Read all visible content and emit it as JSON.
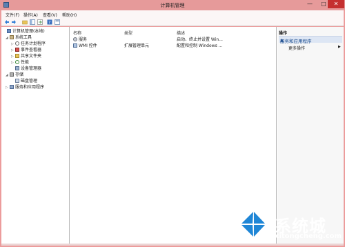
{
  "window": {
    "title": "计算机管理",
    "controls": {
      "minimize": "—",
      "maximize": "□",
      "close": "✕"
    }
  },
  "menubar": {
    "items": [
      "文件(F)",
      "操作(A)",
      "查看(V)",
      "帮助(H)"
    ]
  },
  "toolbar": {
    "buttons": [
      "back-arrow-icon",
      "forward-arrow-icon",
      "folder-up-icon",
      "show-hide-tree-icon",
      "export-list-icon",
      "help-icon",
      "properties-icon"
    ]
  },
  "tree": {
    "items": [
      {
        "label": "计算机管理(本地)",
        "depth": 0,
        "expander": "",
        "icon": "computer-icon"
      },
      {
        "label": "系统工具",
        "depth": 1,
        "expander": "◢",
        "icon": "tools-icon"
      },
      {
        "label": "任务计划程序",
        "depth": 2,
        "expander": "▷",
        "icon": "clock-icon"
      },
      {
        "label": "事件查看器",
        "depth": 2,
        "expander": "▷",
        "icon": "event-viewer-icon"
      },
      {
        "label": "共享文件夹",
        "depth": 2,
        "expander": "▷",
        "icon": "shared-folder-icon"
      },
      {
        "label": "性能",
        "depth": 2,
        "expander": "▷",
        "icon": "performance-icon"
      },
      {
        "label": "设备管理器",
        "depth": 2,
        "expander": "",
        "icon": "device-manager-icon"
      },
      {
        "label": "存储",
        "depth": 1,
        "expander": "◢",
        "icon": "storage-icon"
      },
      {
        "label": "磁盘管理",
        "depth": 2,
        "expander": "",
        "icon": "disk-icon"
      },
      {
        "label": "服务和应用程序",
        "depth": 1,
        "expander": "▷",
        "icon": "services-apps-icon"
      }
    ]
  },
  "list": {
    "columns": [
      "名称",
      "类型",
      "描述"
    ],
    "rows": [
      {
        "name": "服务",
        "type": "",
        "description": "启动、终止并设置 Win...",
        "icon": "services-icon"
      },
      {
        "name": "WMI 控件",
        "type": "扩展管理单元",
        "description": "配置和控制 Windows ...",
        "icon": "wmi-icon"
      }
    ]
  },
  "actions": {
    "header": "操作",
    "section": "服务和应用程序",
    "section_arrow": "▲",
    "items": [
      {
        "label": "更多操作",
        "arrow": "▶"
      }
    ]
  },
  "watermark": {
    "text": "系统城",
    "sub": "xitongcheng.com"
  },
  "colors": {
    "titlebar": "#e69a9a",
    "close_button": "#c53030",
    "action_section_bg": "#dde6f4",
    "action_section_text": "#1d4d8e",
    "watermark_blue": "#1f86d6"
  }
}
